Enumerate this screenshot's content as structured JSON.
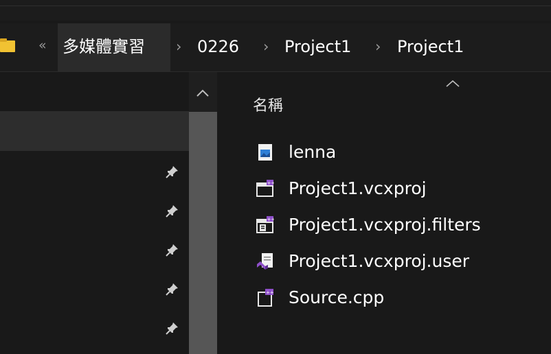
{
  "breadcrumb": {
    "overflow_glyph": "«",
    "items": [
      "多媒體實習",
      "0226",
      "Project1",
      "Project1"
    ],
    "separator": "›"
  },
  "column_header": {
    "name_label": "名稱"
  },
  "files": [
    {
      "name": "lenna",
      "icon": "image-file-icon"
    },
    {
      "name": "Project1.vcxproj",
      "icon": "vc-project-icon"
    },
    {
      "name": "Project1.vcxproj.filters",
      "icon": "vc-filters-icon"
    },
    {
      "name": "Project1.vcxproj.user",
      "icon": "visual-studio-user-icon"
    },
    {
      "name": "Source.cpp",
      "icon": "cpp-source-icon"
    }
  ],
  "colors": {
    "background": "#191919",
    "highlight": "#2d2d2d",
    "folder": "#f1c232",
    "vs_purple": "#8e4fc9",
    "image_blue": "#2f7fd6"
  }
}
